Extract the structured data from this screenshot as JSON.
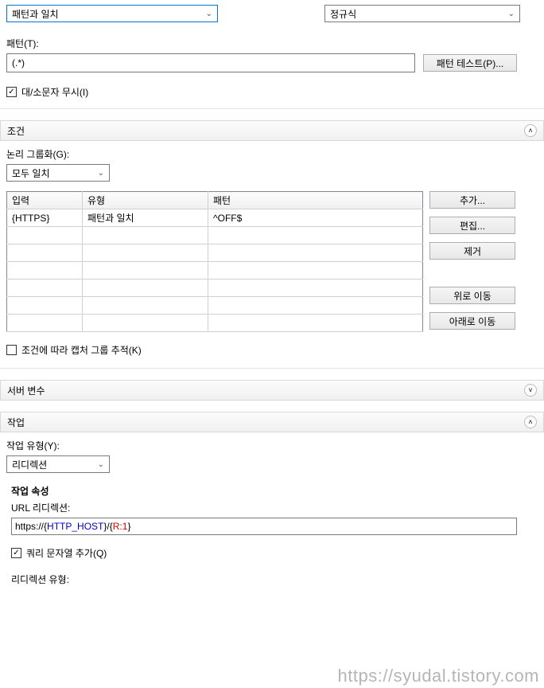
{
  "top": {
    "match_mode_selected": "패턴과 일치",
    "regex_mode_selected": "정규식",
    "pattern_label": "패턴(T):",
    "pattern_value": "(.*)",
    "pattern_test_btn": "패턴 테스트(P)...",
    "ignore_case_label": "대/소문자 무시(I)"
  },
  "conditions": {
    "header": "조건",
    "group_label": "논리 그룹화(G):",
    "group_selected": "모두 일치",
    "columns": {
      "input": "입력",
      "type": "유형",
      "pattern": "패턴"
    },
    "rows": [
      {
        "input": "{HTTPS}",
        "type": "패턴과 일치",
        "pattern": "^OFF$"
      },
      {
        "input": "",
        "type": "",
        "pattern": ""
      },
      {
        "input": "",
        "type": "",
        "pattern": ""
      },
      {
        "input": "",
        "type": "",
        "pattern": ""
      },
      {
        "input": "",
        "type": "",
        "pattern": ""
      },
      {
        "input": "",
        "type": "",
        "pattern": ""
      },
      {
        "input": "",
        "type": "",
        "pattern": ""
      }
    ],
    "buttons": {
      "add": "추가...",
      "edit": "편집...",
      "remove": "제거",
      "move_up": "위로 이동",
      "move_down": "아래로 이동"
    },
    "track_capture_label": "조건에 따라 캡처 그룹 추적(K)"
  },
  "server_vars": {
    "header": "서버 변수"
  },
  "action": {
    "header": "작업",
    "type_label": "작업 유형(Y):",
    "type_selected": "리디렉션",
    "props_label": "작업 속성",
    "url_label": "URL 리디렉션:",
    "url_value_plain": "https://",
    "url_host_var": "HTTP_HOST",
    "url_ref": "R:1",
    "append_query_label": "쿼리 문자열 추가(Q)",
    "redirect_type_label": "리디렉션 유형:"
  },
  "watermark": "https://syudal.tistory.com"
}
